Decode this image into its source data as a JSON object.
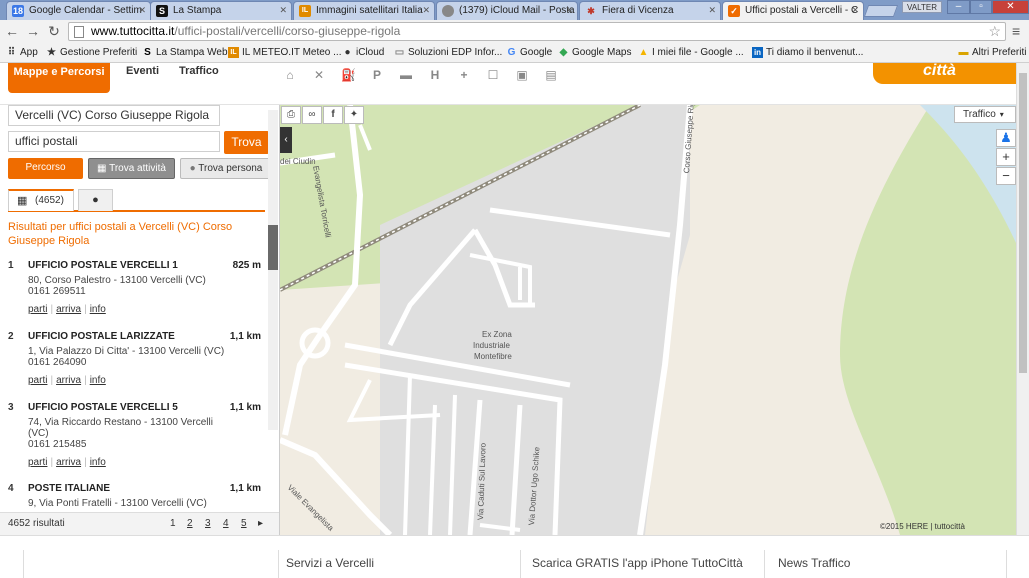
{
  "browser": {
    "tabs": [
      {
        "title": "Google Calendar - Settim",
        "favicon": "calendar-icon",
        "fav_text": "18",
        "fav_color": "#3b78e7"
      },
      {
        "title": "La Stampa",
        "favicon": "la-stampa-icon",
        "fav_text": "S",
        "fav_color": "#111111"
      },
      {
        "title": "Immagini satellitari Italia",
        "favicon": "meteo-icon",
        "fav_text": "IL",
        "fav_color": "#e08a00"
      },
      {
        "title": "(1379) iCloud Mail - Posta",
        "favicon": "icloud-icon",
        "fav_text": "",
        "fav_color": "#888888"
      },
      {
        "title": "Fiera di Vicenza",
        "favicon": "fiera-icon",
        "fav_text": "✱",
        "fav_color": "#c0392b"
      },
      {
        "title": "Uffici postali a Vercelli - C",
        "favicon": "tuttocitta-icon",
        "fav_text": "✓",
        "fav_color": "#ef6c00"
      }
    ],
    "user_label": "VALTER",
    "url_host": "www.tuttocitta.it",
    "url_path": "/uffici-postali/vercelli/corso-giuseppe-rigola",
    "bookmarks": [
      {
        "label": "App",
        "icon": "apps-grid-icon",
        "glyph": "⠿"
      },
      {
        "label": "Gestione Preferiti",
        "icon": "star-icon",
        "glyph": "★"
      },
      {
        "label": "La Stampa Web",
        "icon": "la-stampa-icon",
        "glyph": "S"
      },
      {
        "label": "IL METEO.IT Meteo ...",
        "icon": "meteo-icon",
        "glyph": "IL"
      },
      {
        "label": "iCloud",
        "icon": "apple-icon",
        "glyph": "●"
      },
      {
        "label": "Soluzioni EDP Infor...",
        "icon": "page-icon",
        "glyph": "▭"
      },
      {
        "label": "Google",
        "icon": "google-icon",
        "glyph": "G"
      },
      {
        "label": "Google Maps",
        "icon": "maps-icon",
        "glyph": "◆"
      },
      {
        "label": "I miei file - Google ...",
        "icon": "drive-icon",
        "glyph": "▲"
      },
      {
        "label": "Ti diamo il benvenut...",
        "icon": "linkedin-icon",
        "glyph": "in"
      }
    ],
    "other_bookmarks": "Altri Preferiti"
  },
  "site": {
    "nav_maps": "Mappe e Percorsi",
    "nav_events": "Eventi",
    "nav_traffic": "Traffico",
    "logo": "città",
    "category_icons": [
      "hotel-icon",
      "restaurant-icon",
      "fuel-icon",
      "parking-icon",
      "car-icon",
      "hospital-icon",
      "pharmacy-icon",
      "bar-icon",
      "shop-icon",
      "atm-icon"
    ]
  },
  "search": {
    "where": "Vercelli (VC) Corso Giuseppe Rigola",
    "what": "uffici postali",
    "submit": "Trova",
    "btn_percorso": "Percorso",
    "btn_attivita": "Trova attività",
    "btn_persona": "Trova persona"
  },
  "results": {
    "tab_count": "(4652)",
    "heading": "Risultati per uffici postali a Vercelli (VC) Corso Giuseppe Rigola",
    "items": [
      {
        "num": "1",
        "name": "UFFICIO POSTALE VERCELLI 1",
        "dist": "825 m",
        "addr": "80, Corso Palestro - 13100 Vercelli (VC)",
        "phone": "0161 269511"
      },
      {
        "num": "2",
        "name": "UFFICIO POSTALE LARIZZATE",
        "dist": "1,1 km",
        "addr": "1, Via Palazzo Di Citta' - 13100 Vercelli (VC)",
        "phone": "0161 264090"
      },
      {
        "num": "3",
        "name": "UFFICIO POSTALE VERCELLI 5",
        "dist": "1,1 km",
        "addr": "74, Via Riccardo Restano - 13100 Vercelli (VC)",
        "phone": "0161 215485"
      },
      {
        "num": "4",
        "name": "POSTE ITALIANE",
        "dist": "1,1 km",
        "addr": "9, Via Ponti Fratelli - 13100 Vercelli (VC)",
        "phone": ""
      }
    ],
    "link_parti": "parti",
    "link_arriva": "arriva",
    "link_info": "info",
    "total": "4652 risultati",
    "pages": [
      "1",
      "2",
      "3",
      "4",
      "5"
    ],
    "next": "▸"
  },
  "map": {
    "traffic_label": "Traffico",
    "zoom_in": "+",
    "zoom_out": "−",
    "copyright": "©2015 HERE |  tuttocittà",
    "labels": {
      "ciudin": "dei Ciudin",
      "torricelli": "Evangelista Torricelli",
      "rigola": "Corso Giuseppe Rigola",
      "zona1": "Ex Zona",
      "zona2": "Industriale",
      "zona3": "Montefibre",
      "caduti": "Via Caduti Sul Lavoro",
      "schike": "Via Dottor Ugo Schike",
      "evangelista": "Viale Evangelista"
    }
  },
  "bottom": {
    "servizi": "Servizi a Vercelli",
    "app": "Scarica GRATIS l'app iPhone TuttoCittà",
    "news": "News Traffico"
  }
}
